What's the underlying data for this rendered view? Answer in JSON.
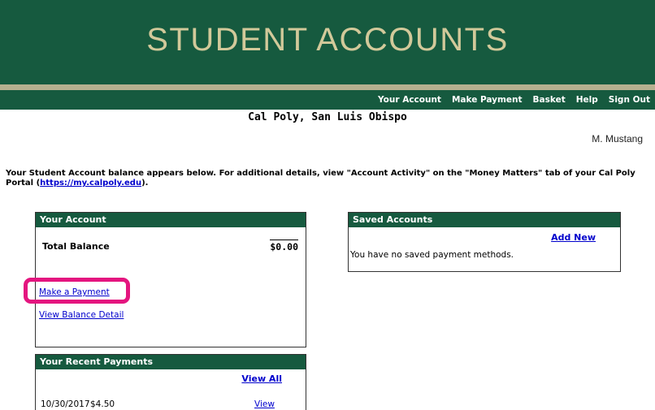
{
  "header": {
    "title": "STUDENT ACCOUNTS",
    "nav": [
      "Your Account",
      "Make Payment",
      "Basket",
      "Help",
      "Sign Out"
    ]
  },
  "campus": "Cal Poly, San Luis Obispo",
  "user_name": "M. Mustang",
  "intro": {
    "text": "Your Student Account balance appears below. For additional details, view \"Account Activity\" on the \"Money Matters\" tab of your Cal Poly Portal (",
    "link": "https://my.calpoly.edu",
    "suffix": ")."
  },
  "your_account": {
    "header": "Your Account",
    "total_label": "Total Balance",
    "total_value": "$0.00",
    "make_payment": "Make a Payment",
    "view_balance": "View Balance Detail"
  },
  "saved_accounts": {
    "header": "Saved Accounts",
    "add_new": "Add New",
    "empty_message": "You have no saved payment methods."
  },
  "recent_payments": {
    "header": "Your Recent Payments",
    "view_all": "View All",
    "rows": [
      {
        "date": "10/30/2017",
        "amount": "$4.50",
        "action": "View"
      }
    ]
  },
  "colors": {
    "brand_green": "#165a3f",
    "brand_gold": "#d2c99a",
    "highlight": "#e4157f",
    "link": "#0000cc"
  }
}
